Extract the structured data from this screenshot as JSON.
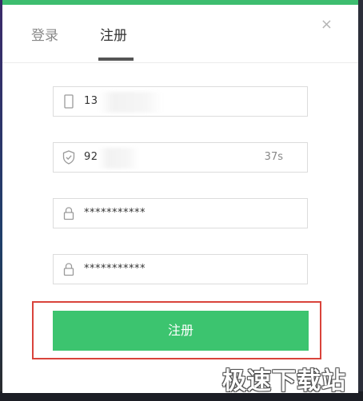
{
  "tabs": [
    {
      "label": "登录",
      "active": false
    },
    {
      "label": "注册",
      "active": true
    }
  ],
  "close_glyph": "×",
  "fields": {
    "phone": {
      "value": "13",
      "icon": "phone-icon"
    },
    "code": {
      "value": "92",
      "countdown": "37s",
      "icon": "shield-icon"
    },
    "password": {
      "value": "***********",
      "icon": "lock-icon"
    },
    "confirm_password": {
      "value": "***********",
      "icon": "lock-icon"
    }
  },
  "submit_label": "注册",
  "watermark": "极速下载站",
  "colors": {
    "accent": "#3cc46f",
    "highlight": "#d9433b",
    "tab_active": "#333333",
    "tab_inactive": "#888888"
  }
}
